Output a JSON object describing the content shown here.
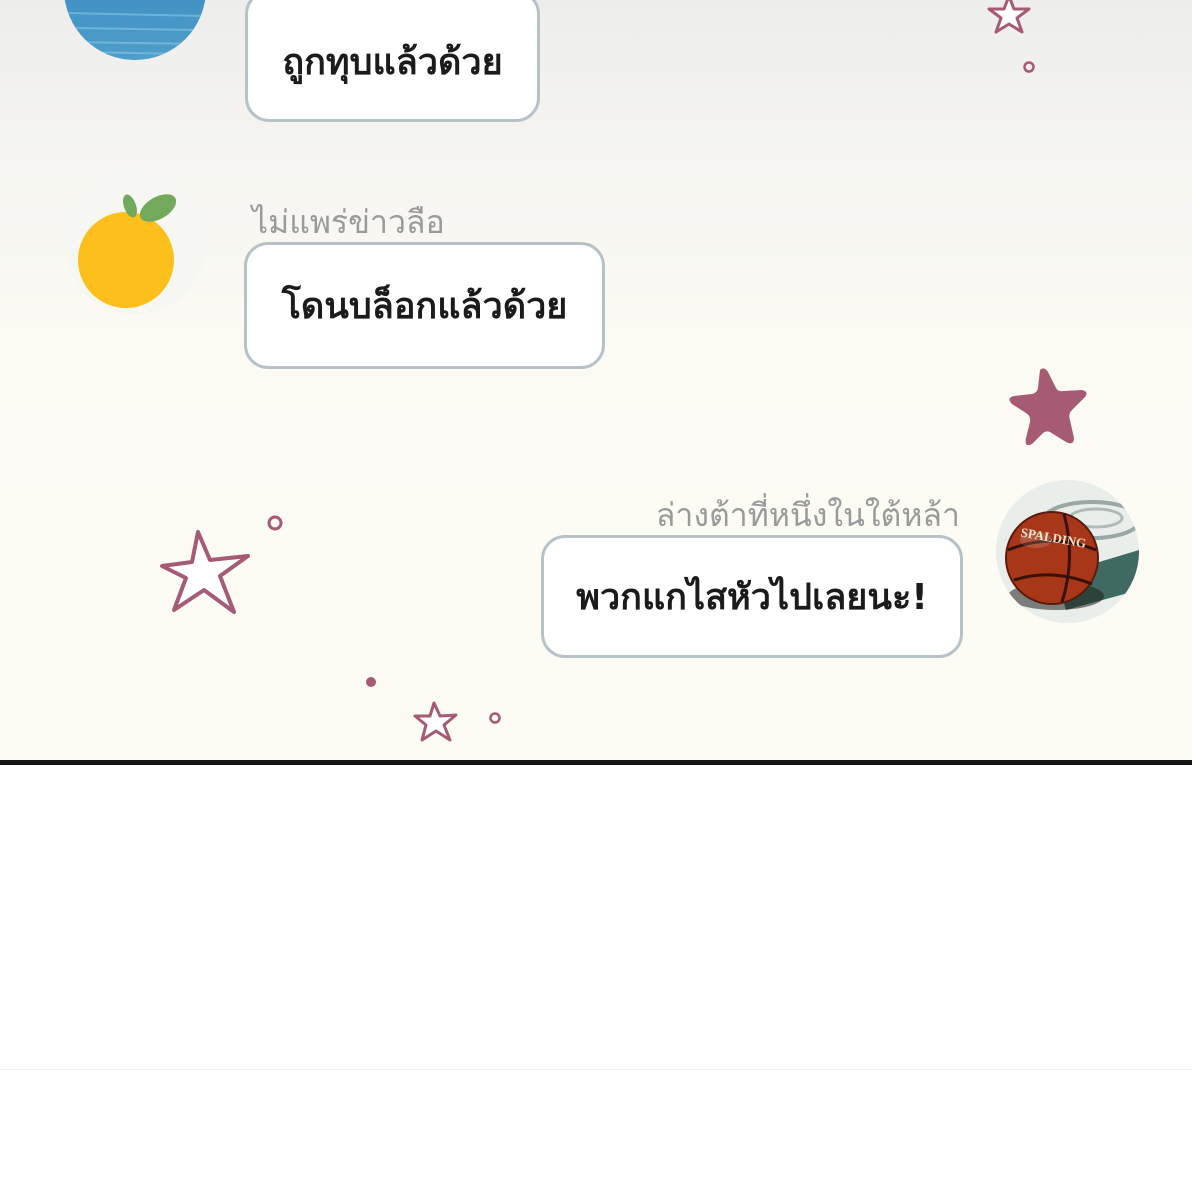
{
  "messages": [
    {
      "sender": "",
      "text": "ถูกทุบแล้วด้วย",
      "side": "left",
      "avatar": "sea-photo"
    },
    {
      "sender": "ไม่แพร่ข่าวลือ",
      "text": "โดนบล็อกแล้วด้วย",
      "side": "left",
      "avatar": "orange-fruit"
    },
    {
      "sender": "ล่างต้าที่หนึ่งในใต้หล้า",
      "text": "พวกแกไสหัวไปเลยนะ!",
      "side": "right",
      "avatar": "basketball-photo"
    }
  ],
  "avatar_labels": {
    "basketball_brand": "SPALDING"
  },
  "colors": {
    "bubble_border": "#b7c2c7",
    "sender_name": "#9a9a9a",
    "star_decoration": "#a65a73",
    "panel_border": "#141414"
  }
}
